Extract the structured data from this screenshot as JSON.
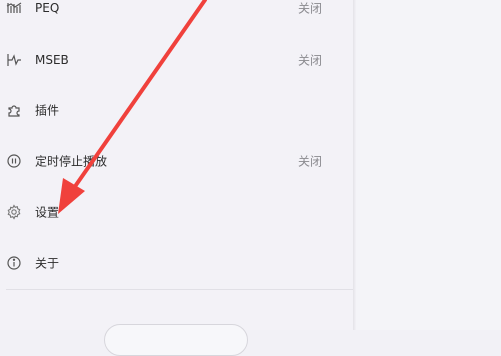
{
  "menu": {
    "items": [
      {
        "label": "PEQ",
        "value": "关闭",
        "icon": "peq-icon"
      },
      {
        "label": "MSEB",
        "value": "关闭",
        "icon": "mseb-icon"
      },
      {
        "label": "插件",
        "value": "",
        "icon": "plugin-icon"
      },
      {
        "label": "定时停止播放",
        "value": "关闭",
        "icon": "timer-icon"
      },
      {
        "label": "设置",
        "value": "",
        "icon": "gear-icon"
      },
      {
        "label": "关于",
        "value": "",
        "icon": "info-icon"
      }
    ]
  },
  "colors": {
    "arrow": "#f0413c",
    "background": "#f3f2f7",
    "label_text": "#2c2c2c",
    "value_text": "#8a8a8f"
  }
}
